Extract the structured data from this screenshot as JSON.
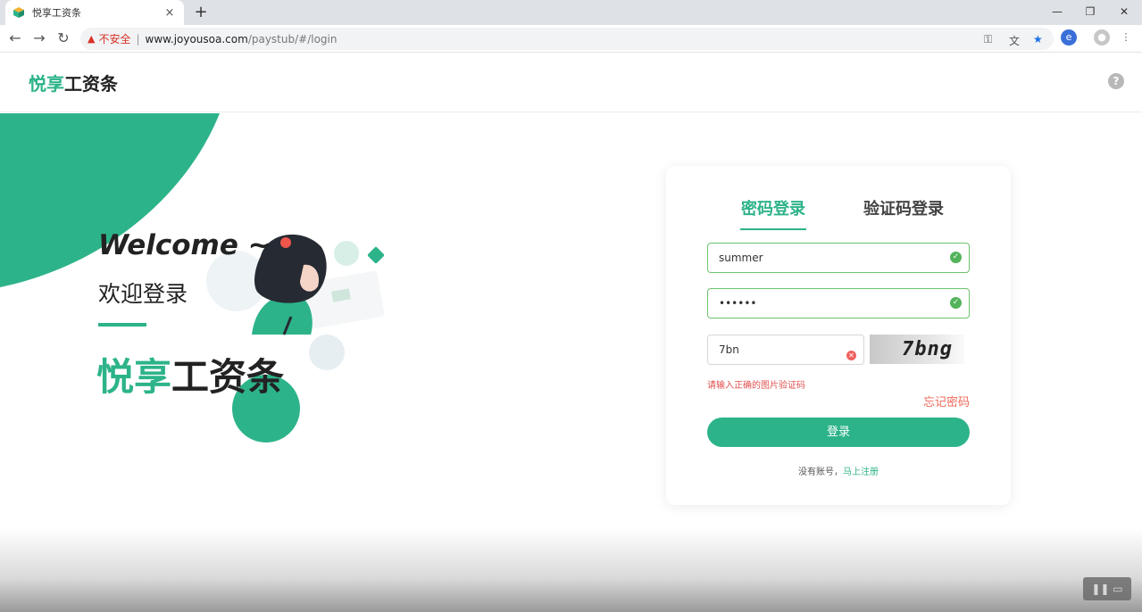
{
  "browser": {
    "tab_title": "悦享工资条",
    "tab_close": "×",
    "new_tab": "+",
    "warning_label": "不安全",
    "separator": "|",
    "url_domain": "www.joyousoa.com",
    "url_path": "/paystub/#/login",
    "back_icon": "←",
    "forward_icon": "→",
    "reload_icon": "↻",
    "minimize": "—",
    "maximize": "❐",
    "close": "✕",
    "menu": "⋮"
  },
  "header": {
    "logo_green": "悦享",
    "logo_dark": "工资条",
    "help": "?"
  },
  "hero": {
    "welcome": "Welcome ~",
    "welcome_cn": "欢迎登录",
    "logo_green": "悦享",
    "logo_dark": "工资条"
  },
  "login": {
    "tabs": [
      {
        "label": "密码登录",
        "active": true
      },
      {
        "label": "验证码登录",
        "active": false
      }
    ],
    "username_value": "summer",
    "password_value": "••••••",
    "captcha_value": "7bn",
    "captcha_image_text": "7bng",
    "error_message": "请输入正确的图片验证码",
    "forgot_label": "忘记密码",
    "submit_label": "登录",
    "signup_prefix": "没有账号，",
    "signup_link": "马上注册"
  },
  "colors": {
    "brand_green": "#2db38a",
    "error_red": "#e05050",
    "valid_green": "#52b35a"
  }
}
